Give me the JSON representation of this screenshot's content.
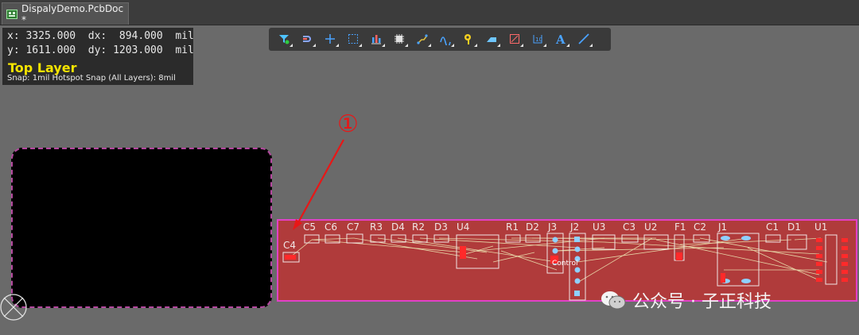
{
  "tab": {
    "title": "DispalyDemo.PcbDoc *"
  },
  "hud": {
    "x_label": "x:",
    "x_value": "3325.000",
    "dx_label": "dx:",
    "dx_value": "894.000",
    "x_unit": "mil",
    "y_label": "y:",
    "y_value": "1611.000",
    "dy_label": "dy:",
    "dy_value": "1203.000",
    "y_unit": "mil",
    "layer": "Top Layer",
    "snap": "Snap: 1mil Hotspot Snap (All Layers): 8mil"
  },
  "toolbar": [
    {
      "icon": "filter-icon",
      "color": "#4ec3ff"
    },
    {
      "icon": "route-interactive-icon",
      "color": "#8aa7ff"
    },
    {
      "icon": "crosshair-icon",
      "color": "#4aa3ff"
    },
    {
      "icon": "select-rect-icon",
      "color": "#4aa3ff"
    },
    {
      "icon": "align-icon",
      "color": "#ff6262"
    },
    {
      "icon": "component-icon",
      "color": "#e0e0e0"
    },
    {
      "icon": "route-icon",
      "color": "#e0c040"
    },
    {
      "icon": "diff-pair-icon",
      "color": "#4aa3ff"
    },
    {
      "icon": "via-icon",
      "color": "#f5d020"
    },
    {
      "icon": "fill-icon",
      "color": "#6ec6ff"
    },
    {
      "icon": "region-icon",
      "color": "#ff6a6a"
    },
    {
      "icon": "dimension-icon",
      "color": "#4aa3ff"
    },
    {
      "icon": "text-icon",
      "color": "#4aa3ff"
    },
    {
      "icon": "line-icon",
      "color": "#4aa3ff"
    }
  ],
  "annotation": {
    "marker": "①"
  },
  "designators": [
    "C4",
    "C5",
    "C6",
    "C7",
    "R3",
    "D4",
    "R2",
    "D3",
    "U4",
    "R1",
    "D2",
    "J3",
    "J2",
    "U3",
    "C3",
    "U2",
    "F1",
    "C2",
    "J1",
    "C1",
    "D1",
    "U1"
  ],
  "board_label": "Control",
  "watermark": {
    "text": "公众号 · 子正科技"
  },
  "colors": {
    "board": "#b03b3b",
    "outline": "#e240c7",
    "silk": "#f0e6e6",
    "ratsnest": "#e8d7a8",
    "pad": "#8fd0ff",
    "arrow": "#e81717",
    "layer_text": "#f5e400"
  }
}
